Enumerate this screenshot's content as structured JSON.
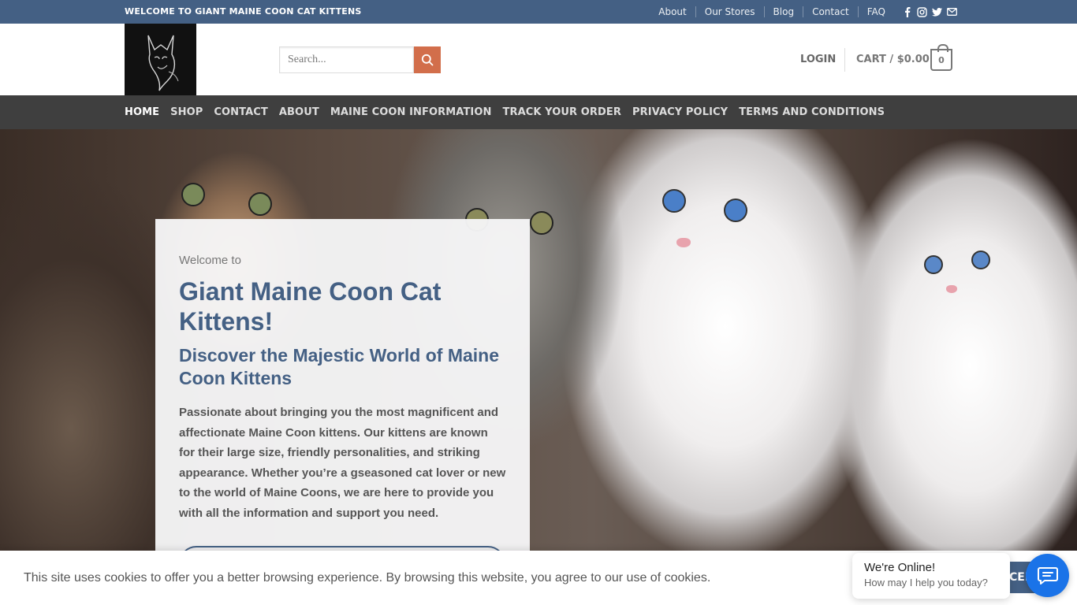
{
  "topbar": {
    "welcome": "WELCOME TO GIANT MAINE COON CAT KITTENS",
    "links": [
      "About",
      "Our Stores",
      "Blog",
      "Contact",
      "FAQ"
    ],
    "social_icons": [
      "facebook-icon",
      "instagram-icon",
      "twitter-icon",
      "email-icon"
    ]
  },
  "header": {
    "search_placeholder": "Search...",
    "login": "LOGIN",
    "cart": "CART / $0.00",
    "cart_count": "0"
  },
  "nav": {
    "items": [
      "HOME",
      "SHOP",
      "CONTACT",
      "ABOUT",
      "MAINE COON INFORMATION",
      "TRACK YOUR ORDER",
      "PRIVACY POLICY",
      "TERMS AND CONDITIONS"
    ],
    "active": "HOME"
  },
  "hero": {
    "pretitle": "Welcome to",
    "title": "Giant Maine Coon Cat Kittens!",
    "subtitle": "Discover the Majestic World of Maine Coon Kittens",
    "body": "Passionate about bringing you the most magnificent and affectionate Maine Coon kittens. Our kittens are known for their large size, friendly personalities, and striking appearance. Whether you’re a gseasoned cat lover or new to the world of Maine Coons, we are here to provide you with all the information and support you need."
  },
  "cookie": {
    "message": "This site uses cookies to offer you a better browsing experience. By browsing this website, you agree to our use of cookies.",
    "accept_visible": "CEPT"
  },
  "chat": {
    "title": "We're Online!",
    "subtitle": "How may I help you today?"
  },
  "colors": {
    "primary": "#446084",
    "accent": "#d26e4b",
    "nav_bg": "#3f3f3f",
    "chat_blue": "#1a73e8"
  }
}
